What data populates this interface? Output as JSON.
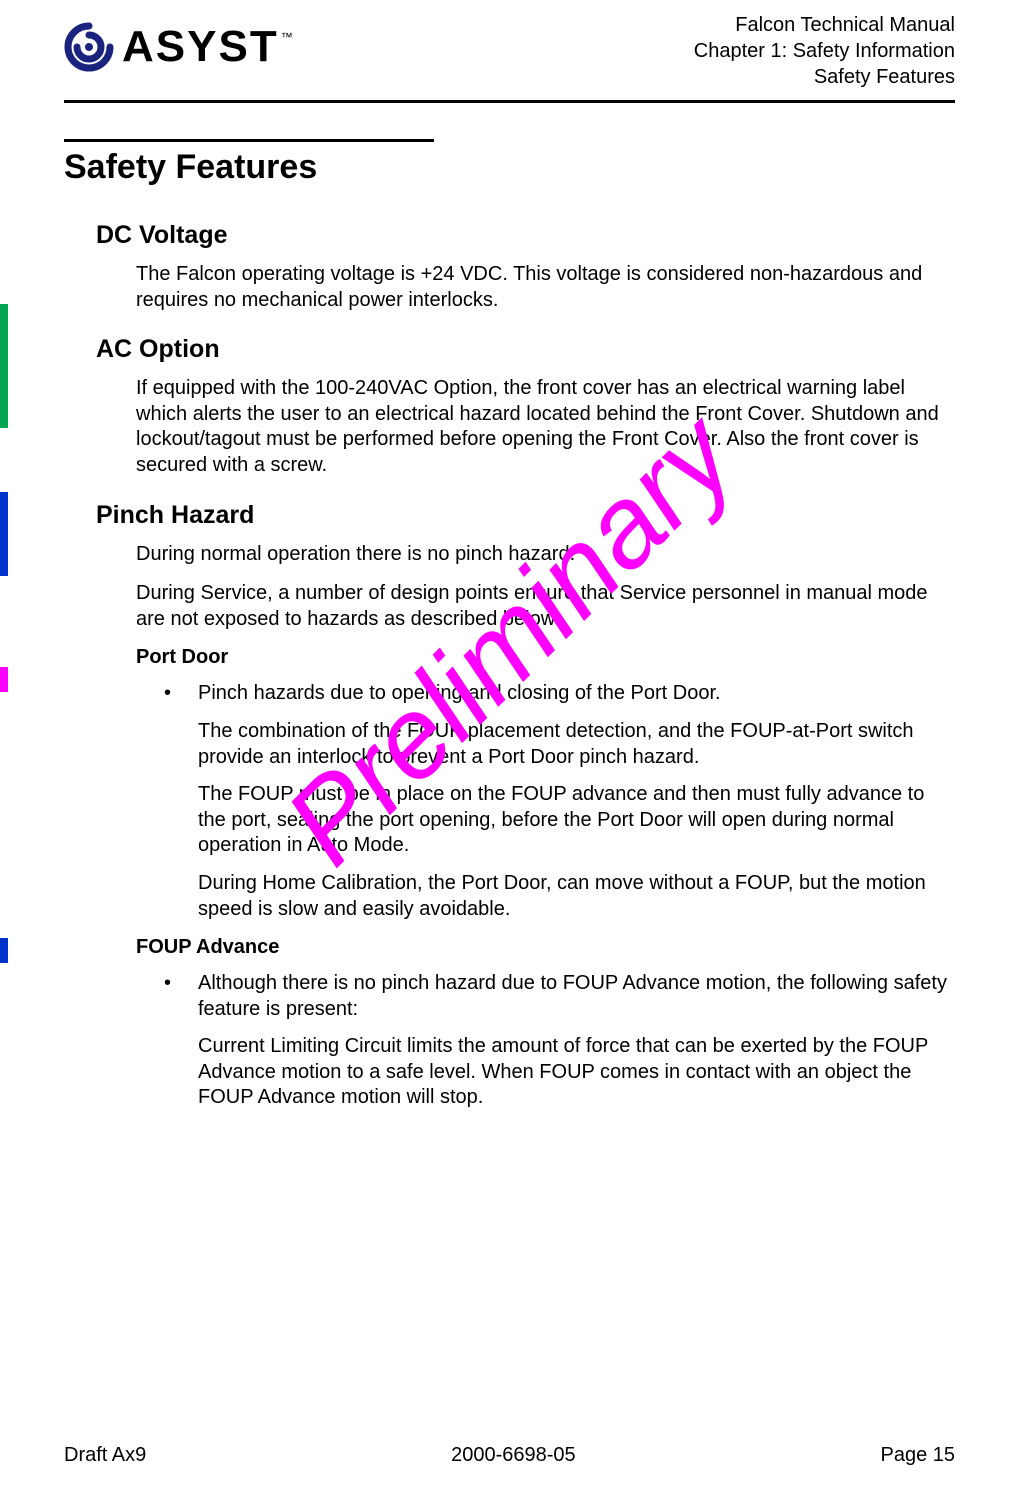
{
  "header": {
    "logo_name": "ASYST",
    "logo_tm": "™",
    "line1": "Falcon Technical Manual",
    "line2": "Chapter 1: Safety Information",
    "line3": "Safety Features"
  },
  "watermark": "Preliminary",
  "page_title": "Safety Features",
  "sec1": {
    "title": "DC Voltage",
    "p1": "The Falcon operating voltage is +24 VDC. This voltage is considered non-hazardous and requires no mechanical power interlocks."
  },
  "sec2": {
    "title": "AC Option",
    "p1": "If equipped with the 100-240VAC Option, the front cover has an electrical warning label which alerts the user to an electrical hazard located behind the Front Cover. Shutdown and lockout/tagout must be performed before opening the Front Cover. Also the front cover is secured with a screw."
  },
  "sec3": {
    "title": "Pinch Hazard",
    "p1": "During normal operation there is no pinch hazard.",
    "p2": "During Service, a number of design points ensure that Service personnel in manual mode are not exposed to hazards as described below:",
    "sub1": {
      "title": "Port Door",
      "b1": "Pinch hazards due to opening and closing of the Port Door.",
      "p1": "The combination of the FOUP placement detection, and the FOUP-at-Port switch provide an interlock to prevent a Port Door pinch hazard.",
      "p2": "The FOUP must be in place on the FOUP advance and then must fully advance to the port, sealing the port opening, before the Port Door will open during normal operation in Auto Mode.",
      "p3": "During Home Calibration, the Port Door, can move without a FOUP, but the motion speed is slow and easily avoidable."
    },
    "sub2": {
      "title": "FOUP Advance",
      "b1": "Although there is no pinch hazard due to FOUP Advance motion, the following safety feature is present:",
      "p1": "Current Limiting Circuit limits the amount of force that can be exerted by the FOUP Advance motion to a safe level. When FOUP comes in contact with an object the FOUP Advance motion will stop."
    }
  },
  "footer": {
    "left": "Draft Ax9",
    "center": "2000-6698-05",
    "right": "Page 15"
  }
}
